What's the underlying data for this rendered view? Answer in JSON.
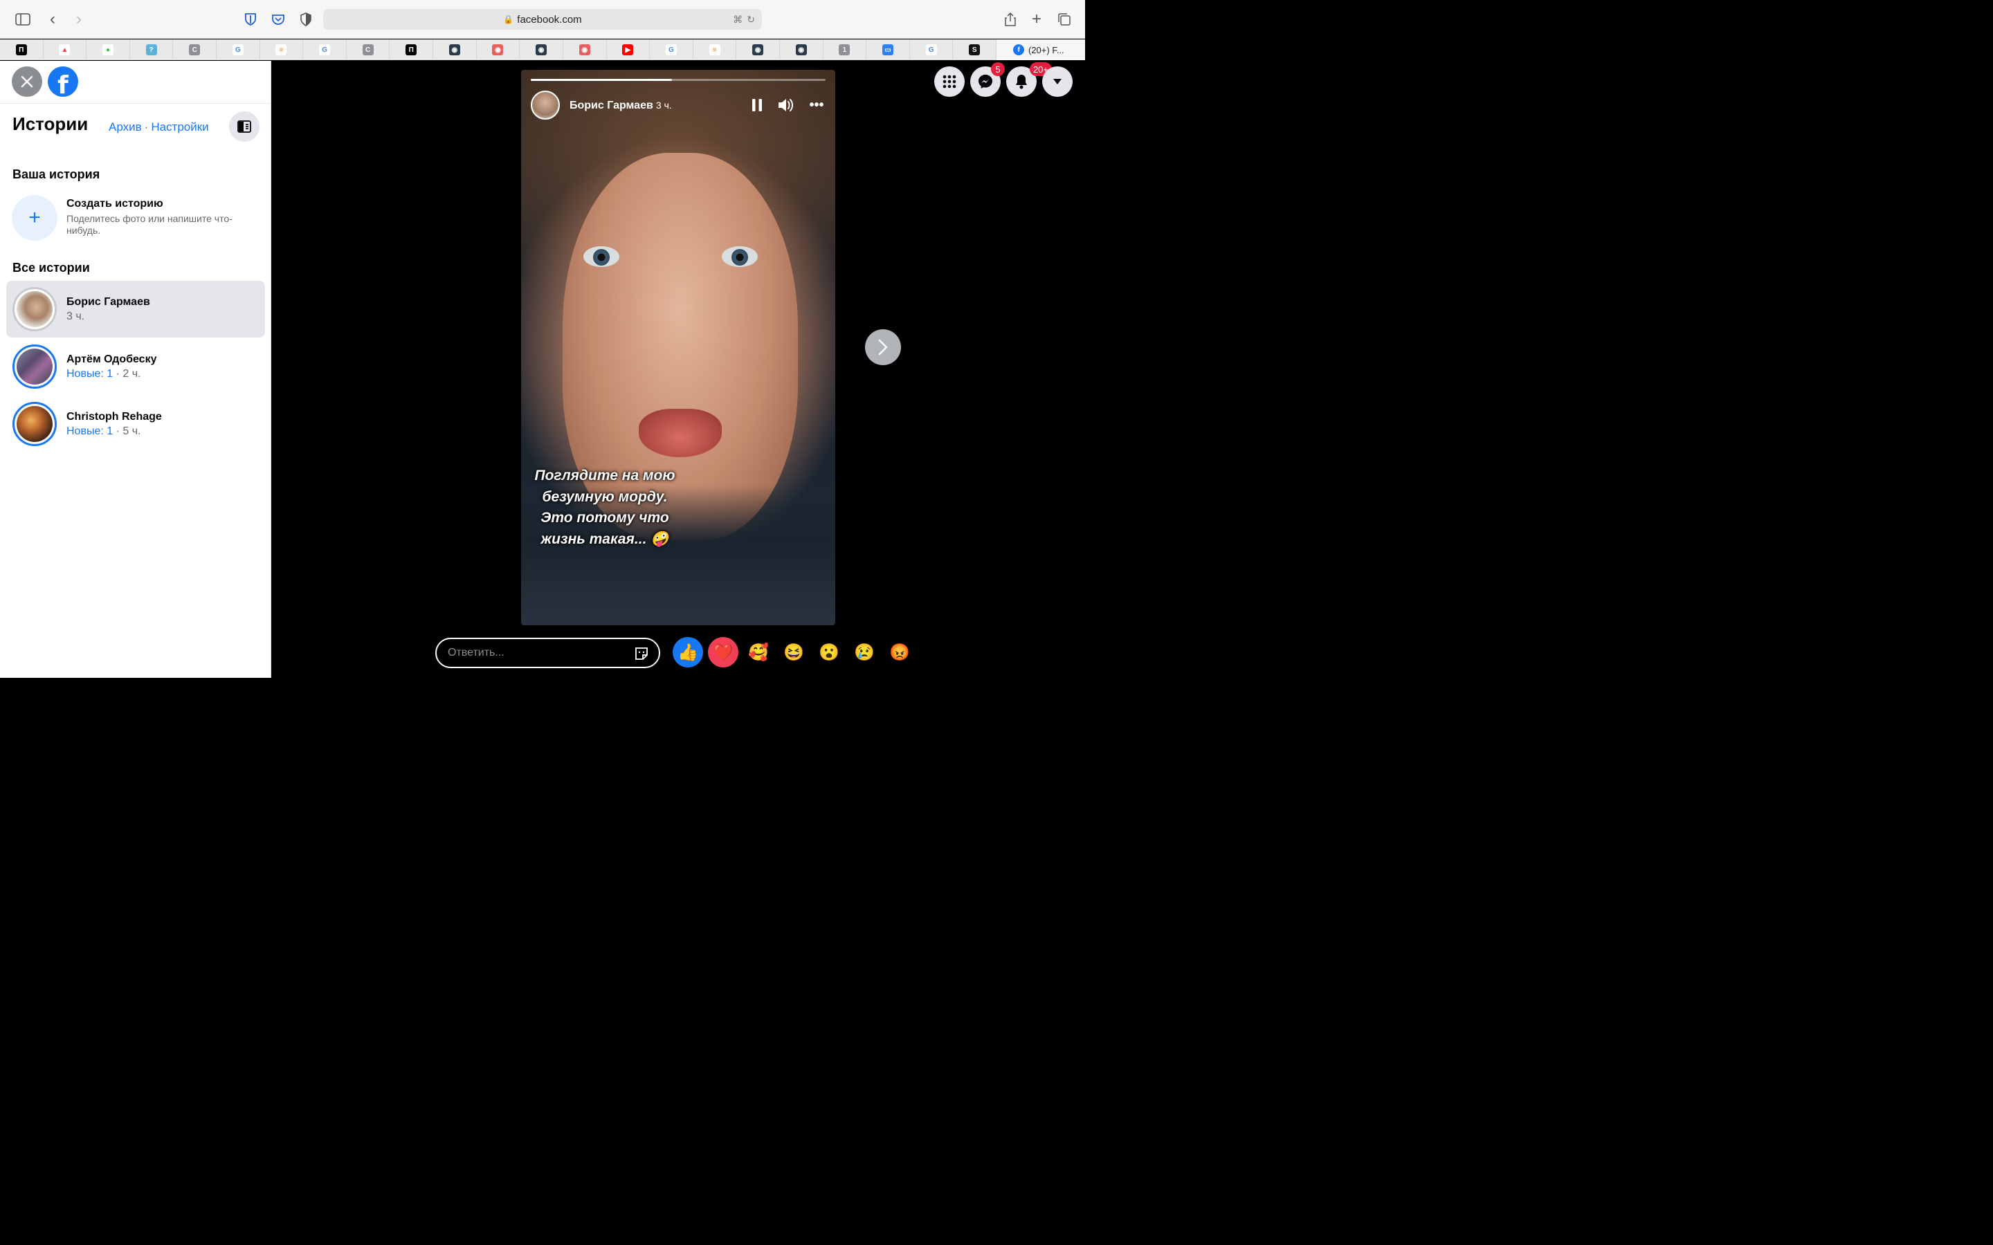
{
  "browser": {
    "url": "facebook.com",
    "active_tab_title": "(20+) F...",
    "tab_favicons": [
      "prism-icon",
      "stack-icon",
      "dot-icon",
      "tool-icon",
      "c-icon",
      "google-icon",
      "so-icon",
      "google-icon",
      "c-icon",
      "prism-icon",
      "eye-icon",
      "color-eye-icon",
      "eye-icon",
      "color-eye-icon",
      "youtube-icon",
      "google-icon",
      "so-icon",
      "eye-icon",
      "eye-icon",
      "one-icon",
      "chat-icon",
      "google-icon",
      "steam-icon"
    ]
  },
  "sidebar": {
    "title": "Истории",
    "archive_link": "Архив",
    "link_separator": "·",
    "settings_link": "Настройки",
    "your_story_heading": "Ваша история",
    "create_title": "Создать историю",
    "create_subtitle": "Поделитесь фото или напишите что-нибудь.",
    "all_stories_heading": "Все истории",
    "stories": [
      {
        "name": "Борис Гармаев",
        "new_label": "",
        "time": "3 ч.",
        "seen": true
      },
      {
        "name": "Артём Одобеску",
        "new_label": "Новые: 1",
        "time": " · 2 ч.",
        "seen": false
      },
      {
        "name": "Christoph Rehage",
        "new_label": "Новые: 1",
        "time": " · 5 ч.",
        "seen": false
      }
    ]
  },
  "topnav": {
    "messenger_badge": "5",
    "notifications_badge": "20+"
  },
  "story_viewer": {
    "author": "Борис Гармаев",
    "time": "3 ч.",
    "progress": 0.48,
    "caption": "Поглядите на мою безумную морду. Это потому что жизнь такая... 🤪"
  },
  "reply": {
    "placeholder": "Ответить..."
  },
  "reactions": [
    "👍",
    "❤️",
    "🥰",
    "😆",
    "😮",
    "😢",
    "😡"
  ],
  "colors": {
    "accent": "#1877f2",
    "badge": "#e41e3f"
  }
}
